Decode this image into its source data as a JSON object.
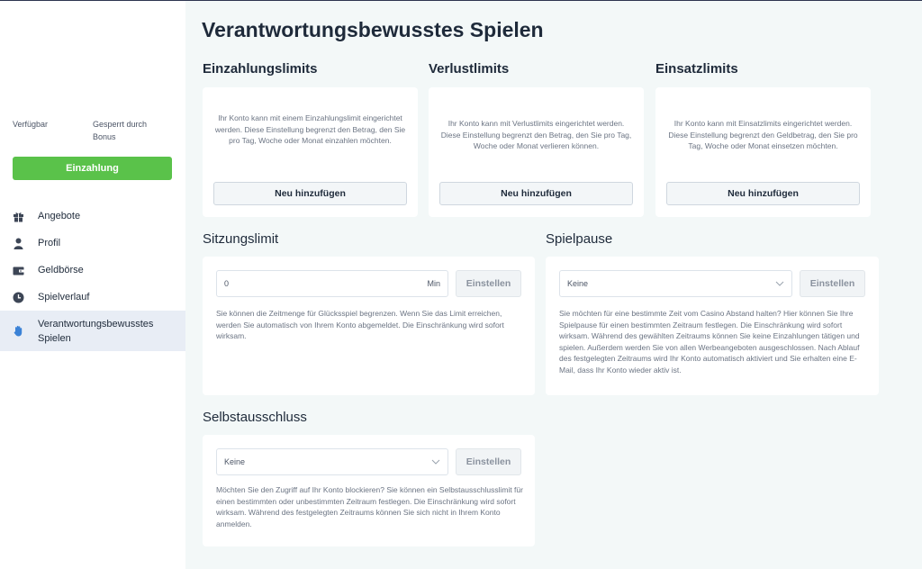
{
  "sidebar": {
    "available_label": "Verfügbar",
    "blocked_label_line1": "Gesperrt durch",
    "blocked_label_line2": "Bonus",
    "deposit_button": "Einzahlung",
    "items": [
      {
        "label": "Angebote",
        "icon": "gift-icon"
      },
      {
        "label": "Profil",
        "icon": "user-icon"
      },
      {
        "label": "Geldbörse",
        "icon": "wallet-icon"
      },
      {
        "label": "Spielverlauf",
        "icon": "clock-icon"
      },
      {
        "label_line1": "Verantwortungsbewusstes",
        "label_line2": "Spielen",
        "icon": "hand-icon",
        "active": true
      }
    ]
  },
  "main": {
    "title": "Verantwortungsbewusstes Spielen",
    "deposit_limits": {
      "title": "Einzahlungslimits",
      "text": "Ihr Konto kann mit einem Einzahlungslimit eingerichtet werden. Diese Einstellung begrenzt den Betrag, den Sie pro Tag, Woche oder Monat einzahlen möchten.",
      "button": "Neu hinzufügen"
    },
    "loss_limits": {
      "title": "Verlustlimits",
      "text": "Ihr Konto kann mit Verlustlimits eingerichtet werden. Diese Einstellung begrenzt den Betrag, den Sie pro Tag, Woche oder Monat verlieren können.",
      "button": "Neu hinzufügen"
    },
    "wager_limits": {
      "title": "Einsatzlimits",
      "text": "Ihr Konto kann mit Einsatzlimits eingerichtet werden. Diese Einstellung begrenzt den Geldbetrag, den Sie pro Tag, Woche oder Monat einsetzen möchten.",
      "button": "Neu hinzufügen"
    },
    "session_limit": {
      "title": "Sitzungslimit",
      "input_value": "0",
      "unit": "Min",
      "button": "Einstellen",
      "text": "Sie können die Zeitmenge für Glücksspiel begrenzen. Wenn Sie das Limit erreichen, werden Sie automatisch von Ihrem Konto abgemeldet. Die Einschränkung wird sofort wirksam."
    },
    "game_break": {
      "title": "Spielpause",
      "select_value": "Keine",
      "button": "Einstellen",
      "text": "Sie möchten für eine bestimmte Zeit vom Casino Abstand halten? Hier können Sie Ihre Spielpause für einen bestimmten Zeitraum festlegen. Die Einschränkung wird sofort wirksam. Während des gewählten Zeitraums können Sie keine Einzahlungen tätigen und spielen. Außerdem werden Sie von allen Werbeangeboten ausgeschlossen. Nach Ablauf des festgelegten Zeitraums wird Ihr Konto automatisch aktiviert und Sie erhalten eine E-Mail, dass Ihr Konto wieder aktiv ist."
    },
    "self_exclusion": {
      "title": "Selbstausschluss",
      "select_value": "Keine",
      "button": "Einstellen",
      "text": "Möchten Sie den Zugriff auf Ihr Konto blockieren? Sie können ein Selbstausschlusslimit für einen bestimmten oder unbestimmten Zeitraum festlegen. Die Einschränkung wird sofort wirksam. Während des festgelegten Zeitraums können Sie sich nicht in Ihrem Konto anmelden."
    }
  }
}
